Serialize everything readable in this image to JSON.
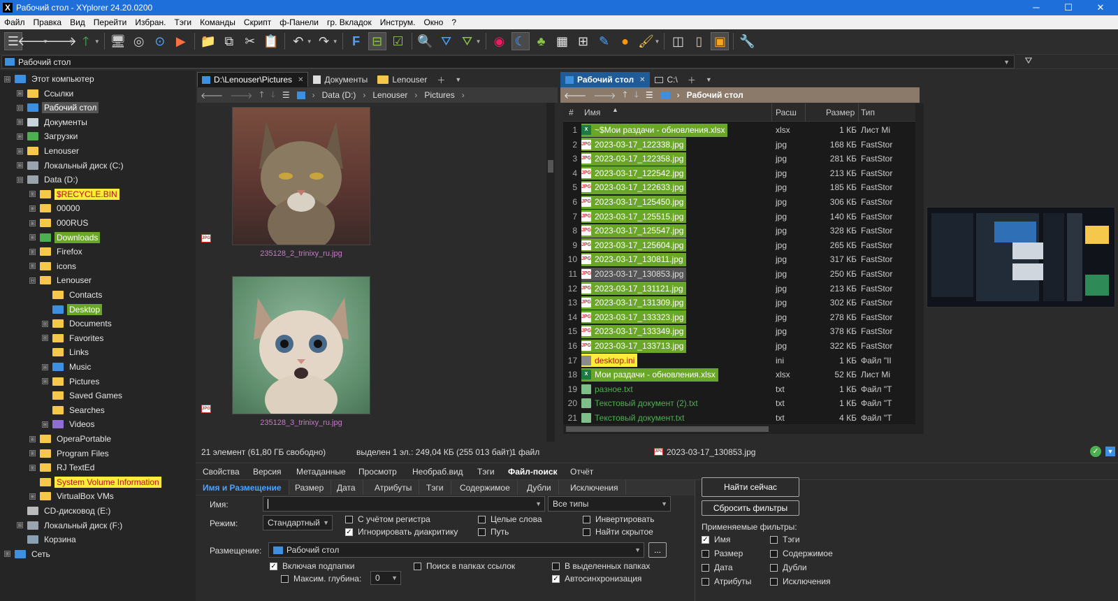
{
  "window": {
    "title": "Рабочий стол - XYplorer 24.20.0200",
    "min": "─",
    "max": "☐",
    "close": "✕"
  },
  "menu": [
    "Файл",
    "Правка",
    "Вид",
    "Перейти",
    "Избран.",
    "Тэги",
    "Команды",
    "Скрипт",
    "ф-Панели",
    "гр. Вкладок",
    "Инструм.",
    "Окно",
    "?"
  ],
  "addressbar": {
    "value": "Рабочий стол"
  },
  "tree": [
    {
      "label": "Этот компьютер",
      "level": 0,
      "exp": "⊟",
      "icon": "pc",
      "hl": ""
    },
    {
      "label": "Ссылки",
      "level": 1,
      "exp": "⊞",
      "icon": "folder",
      "hl": ""
    },
    {
      "label": "Рабочий стол",
      "level": 1,
      "exp": "⊟",
      "icon": "desktop",
      "hl": "sel"
    },
    {
      "label": "Документы",
      "level": 1,
      "exp": "⊞",
      "icon": "doc",
      "hl": ""
    },
    {
      "label": "Загрузки",
      "level": 1,
      "exp": "⊞",
      "icon": "dl",
      "hl": ""
    },
    {
      "label": "Lenouser",
      "level": 1,
      "exp": "⊞",
      "icon": "folder",
      "hl": ""
    },
    {
      "label": "Локальный диск (C:)",
      "level": 1,
      "exp": "⊞",
      "icon": "drive",
      "hl": ""
    },
    {
      "label": "Data (D:)",
      "level": 1,
      "exp": "⊟",
      "icon": "drive",
      "hl": ""
    },
    {
      "label": "$RECYCLE.BIN",
      "level": 2,
      "exp": "⊞",
      "icon": "folder",
      "hl": "yellow"
    },
    {
      "label": "00000",
      "level": 2,
      "exp": "⊞",
      "icon": "folder",
      "hl": ""
    },
    {
      "label": "000RUS",
      "level": 2,
      "exp": "⊞",
      "icon": "folder",
      "hl": ""
    },
    {
      "label": "Downloads",
      "level": 2,
      "exp": "⊞",
      "icon": "dl",
      "hl": "green"
    },
    {
      "label": "Firefox",
      "level": 2,
      "exp": "⊞",
      "icon": "folder",
      "hl": ""
    },
    {
      "label": "icons",
      "level": 2,
      "exp": "⊞",
      "icon": "folder",
      "hl": ""
    },
    {
      "label": "Lenouser",
      "level": 2,
      "exp": "⊟",
      "icon": "folder",
      "hl": ""
    },
    {
      "label": "Contacts",
      "level": 3,
      "exp": "",
      "icon": "folder",
      "hl": ""
    },
    {
      "label": "Desktop",
      "level": 3,
      "exp": "",
      "icon": "desktop",
      "hl": "green"
    },
    {
      "label": "Documents",
      "level": 3,
      "exp": "⊞",
      "icon": "folder",
      "hl": ""
    },
    {
      "label": "Favorites",
      "level": 3,
      "exp": "⊞",
      "icon": "folder",
      "hl": ""
    },
    {
      "label": "Links",
      "level": 3,
      "exp": "",
      "icon": "folder",
      "hl": ""
    },
    {
      "label": "Music",
      "level": 3,
      "exp": "⊞",
      "icon": "music",
      "hl": ""
    },
    {
      "label": "Pictures",
      "level": 3,
      "exp": "⊞",
      "icon": "folder",
      "hl": ""
    },
    {
      "label": "Saved Games",
      "level": 3,
      "exp": "",
      "icon": "folder",
      "hl": ""
    },
    {
      "label": "Searches",
      "level": 3,
      "exp": "",
      "icon": "folder",
      "hl": ""
    },
    {
      "label": "Videos",
      "level": 3,
      "exp": "⊞",
      "icon": "video",
      "hl": ""
    },
    {
      "label": "OperaPortable",
      "level": 2,
      "exp": "⊞",
      "icon": "folder",
      "hl": ""
    },
    {
      "label": "Program Files",
      "level": 2,
      "exp": "⊞",
      "icon": "folder",
      "hl": ""
    },
    {
      "label": "RJ TextEd",
      "level": 2,
      "exp": "⊞",
      "icon": "folder",
      "hl": ""
    },
    {
      "label": "System Volume Information",
      "level": 2,
      "exp": "",
      "icon": "folder",
      "hl": "yellow"
    },
    {
      "label": "VirtualBox VMs",
      "level": 2,
      "exp": "⊞",
      "icon": "folder",
      "hl": ""
    },
    {
      "label": "CD-дисковод (E:)",
      "level": 1,
      "exp": "",
      "icon": "cd",
      "hl": ""
    },
    {
      "label": "Локальный диск (F:)",
      "level": 1,
      "exp": "⊞",
      "icon": "drive",
      "hl": ""
    },
    {
      "label": "Корзина",
      "level": 1,
      "exp": "",
      "icon": "bin",
      "hl": ""
    },
    {
      "label": "Сеть",
      "level": 0,
      "exp": "⊞",
      "icon": "net",
      "hl": ""
    }
  ],
  "left_pane": {
    "tabs": [
      "D:\\Lenouser\\Pictures",
      "Документы",
      "Lenouser"
    ],
    "breadcrumb": [
      "Data (D:)",
      "Lenouser",
      "Pictures"
    ],
    "thumbs": [
      {
        "caption": "235128_2_trinixy_ru.jpg",
        "badge": "JPG"
      },
      {
        "caption": "235128_3_trinixy_ru.jpg",
        "badge": "JPG"
      }
    ]
  },
  "right_pane": {
    "tabs": [
      "Рабочий стол",
      "C:\\"
    ],
    "breadcrumb": [
      "Рабочий стол"
    ],
    "columns": {
      "num": "#",
      "name": "Имя",
      "ext": "Расш",
      "size": "Размер",
      "type": "Тип"
    },
    "rows": [
      {
        "n": "1",
        "name": "~$Мои раздачи - обновления.xlsx",
        "ext": "xlsx",
        "size": "1 КБ",
        "type": "Лист Mi",
        "kind": "xls",
        "hl": "green"
      },
      {
        "n": "2",
        "name": "2023-03-17_122338.jpg",
        "ext": "jpg",
        "size": "168 КБ",
        "type": "FastStor",
        "kind": "jpg",
        "hl": "green"
      },
      {
        "n": "3",
        "name": "2023-03-17_122358.jpg",
        "ext": "jpg",
        "size": "281 КБ",
        "type": "FastStor",
        "kind": "jpg",
        "hl": "green"
      },
      {
        "n": "4",
        "name": "2023-03-17_122542.jpg",
        "ext": "jpg",
        "size": "213 КБ",
        "type": "FastStor",
        "kind": "jpg",
        "hl": "green"
      },
      {
        "n": "5",
        "name": "2023-03-17_122633.jpg",
        "ext": "jpg",
        "size": "185 КБ",
        "type": "FastStor",
        "kind": "jpg",
        "hl": "green"
      },
      {
        "n": "6",
        "name": "2023-03-17_125450.jpg",
        "ext": "jpg",
        "size": "306 КБ",
        "type": "FastStor",
        "kind": "jpg",
        "hl": "green"
      },
      {
        "n": "7",
        "name": "2023-03-17_125515.jpg",
        "ext": "jpg",
        "size": "140 КБ",
        "type": "FastStor",
        "kind": "jpg",
        "hl": "green"
      },
      {
        "n": "8",
        "name": "2023-03-17_125547.jpg",
        "ext": "jpg",
        "size": "328 КБ",
        "type": "FastStor",
        "kind": "jpg",
        "hl": "green"
      },
      {
        "n": "9",
        "name": "2023-03-17_125604.jpg",
        "ext": "jpg",
        "size": "265 КБ",
        "type": "FastStor",
        "kind": "jpg",
        "hl": "green"
      },
      {
        "n": "10",
        "name": "2023-03-17_130811.jpg",
        "ext": "jpg",
        "size": "317 КБ",
        "type": "FastStor",
        "kind": "jpg",
        "hl": "green"
      },
      {
        "n": "11",
        "name": "2023-03-17_130853.jpg",
        "ext": "jpg",
        "size": "250 КБ",
        "type": "FastStor",
        "kind": "jpg",
        "hl": "sel"
      },
      {
        "n": "12",
        "name": "2023-03-17_131121.jpg",
        "ext": "jpg",
        "size": "213 КБ",
        "type": "FastStor",
        "kind": "jpg",
        "hl": "green"
      },
      {
        "n": "13",
        "name": "2023-03-17_131309.jpg",
        "ext": "jpg",
        "size": "302 КБ",
        "type": "FastStor",
        "kind": "jpg",
        "hl": "green"
      },
      {
        "n": "14",
        "name": "2023-03-17_133323.jpg",
        "ext": "jpg",
        "size": "278 КБ",
        "type": "FastStor",
        "kind": "jpg",
        "hl": "green"
      },
      {
        "n": "15",
        "name": "2023-03-17_133349.jpg",
        "ext": "jpg",
        "size": "378 КБ",
        "type": "FastStor",
        "kind": "jpg",
        "hl": "green"
      },
      {
        "n": "16",
        "name": "2023-03-17_133713.jpg",
        "ext": "jpg",
        "size": "322 КБ",
        "type": "FastStor",
        "kind": "jpg",
        "hl": "green"
      },
      {
        "n": "17",
        "name": "desktop.ini",
        "ext": "ini",
        "size": "1 КБ",
        "type": "Файл \"II",
        "kind": "ini",
        "hl": "yellow"
      },
      {
        "n": "18",
        "name": "Мои раздачи - обновления.xlsx",
        "ext": "xlsx",
        "size": "52 КБ",
        "type": "Лист Mi",
        "kind": "xls",
        "hl": "green"
      },
      {
        "n": "19",
        "name": "разное.txt",
        "ext": "txt",
        "size": "1 КБ",
        "type": "Файл \"T",
        "kind": "txt",
        "hl": "txt"
      },
      {
        "n": "20",
        "name": "Текстовый документ (2).txt",
        "ext": "txt",
        "size": "1 КБ",
        "type": "Файл \"T",
        "kind": "txt",
        "hl": "txt"
      },
      {
        "n": "21",
        "name": "Текстовый документ.txt",
        "ext": "txt",
        "size": "4 КБ",
        "type": "Файл \"T",
        "kind": "txt",
        "hl": "txt"
      }
    ]
  },
  "statusbar": {
    "items": "21 элемент (61,80 ГБ свободно)",
    "selected": "выделен 1 эл.: 249,04 КБ (255 013 байт)",
    "files": "1 файл",
    "current": "2023-03-17_130853.jpg"
  },
  "info_panel": {
    "tabs": [
      "Свойства",
      "Версия",
      "Метаданные",
      "Просмотр",
      "Необраб.вид",
      "Тэги",
      "Файл-поиск",
      "Отчёт"
    ],
    "subtabs": [
      "Имя и Размещение",
      "Размер",
      "Дата",
      "Атрибуты",
      "Тэги",
      "Содержимое",
      "Дубли",
      "Исключения"
    ],
    "name_label": "Имя:",
    "name_value": "",
    "types_value": "Все типы",
    "mode_label": "Режим:",
    "mode_value": "Стандартный",
    "location_label": "Размещение:",
    "location_value": "Рабочий стол",
    "browse": "...",
    "depth_label": "Максим. глубина:",
    "depth_value": "0",
    "checks": {
      "case": "С учётом регистра",
      "diacritics": "Игнорировать диакритику",
      "whole": "Целые слова",
      "path": "Путь",
      "invert": "Инвертировать",
      "hidden": "Найти скрытое",
      "subfolders": "Включая подпапки",
      "links": "Поиск в папках ссылок",
      "selected": "В выделенных папках",
      "autosync": "Автосинхронизация",
      "maxdepth": "Максим. глубина:"
    },
    "find_now": "Найти сейчас",
    "reset": "Сбросить фильтры",
    "applied_label": "Применяемые фильтры:",
    "filters": [
      "Имя",
      "Тэги",
      "Размер",
      "Содержимое",
      "Дата",
      "Дубли",
      "Атрибуты",
      "Исключения"
    ]
  }
}
